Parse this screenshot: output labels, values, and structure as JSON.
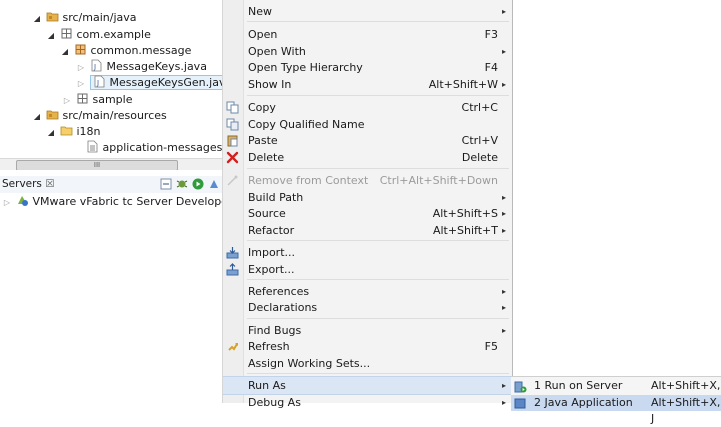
{
  "project_tree": {
    "rows": [
      {
        "label": "src/main/java"
      },
      {
        "label": "com.example"
      },
      {
        "label": "common.message"
      },
      {
        "label": "MessageKeys.java"
      },
      {
        "label": "MessageKeysGen.java"
      },
      {
        "label": "sample"
      },
      {
        "label": "src/main/resources"
      },
      {
        "label": "i18n"
      },
      {
        "label": "application-messages.propert"
      }
    ],
    "scroll_grip": "III"
  },
  "servers": {
    "tab_label": "Servers",
    "close_glyph": "☒",
    "server_label": "VMware vFabric tc Server Developer Editio"
  },
  "context_menu": {
    "items": [
      {
        "label": "New",
        "arrow": "▸"
      },
      {
        "label": "Open",
        "accel": "F3"
      },
      {
        "label": "Open With",
        "arrow": "▸"
      },
      {
        "label": "Open Type Hierarchy",
        "accel": "F4"
      },
      {
        "label": "Show In",
        "accel": "Alt+Shift+W",
        "arrow": "▸"
      },
      {
        "label": "Copy",
        "accel": "Ctrl+C"
      },
      {
        "label": "Copy Qualified Name"
      },
      {
        "label": "Paste",
        "accel": "Ctrl+V"
      },
      {
        "label": "Delete",
        "accel": "Delete"
      },
      {
        "label": "Remove from Context",
        "accel": "Ctrl+Alt+Shift+Down"
      },
      {
        "label": "Build Path",
        "arrow": "▸"
      },
      {
        "label": "Source",
        "accel": "Alt+Shift+S",
        "arrow": "▸"
      },
      {
        "label": "Refactor",
        "accel": "Alt+Shift+T",
        "arrow": "▸"
      },
      {
        "label": "Import..."
      },
      {
        "label": "Export..."
      },
      {
        "label": "References",
        "arrow": "▸"
      },
      {
        "label": "Declarations",
        "arrow": "▸"
      },
      {
        "label": "Find Bugs",
        "arrow": "▸"
      },
      {
        "label": "Refresh",
        "accel": "F5"
      },
      {
        "label": "Assign Working Sets..."
      },
      {
        "label": "Run As",
        "arrow": "▸"
      },
      {
        "label": "Debug As",
        "arrow": "▸"
      }
    ]
  },
  "run_as_submenu": {
    "items": [
      {
        "label": "1 Run on Server",
        "accel": "Alt+Shift+X, R"
      },
      {
        "label": "2 Java Application",
        "accel": "Alt+Shift+X, J"
      }
    ]
  },
  "colors": {
    "menu_background": "#f3f3f3",
    "highlight": "#dbe6f4",
    "folder": "#e0a63a",
    "package": "#a8651f",
    "delete_red": "#d02020"
  }
}
